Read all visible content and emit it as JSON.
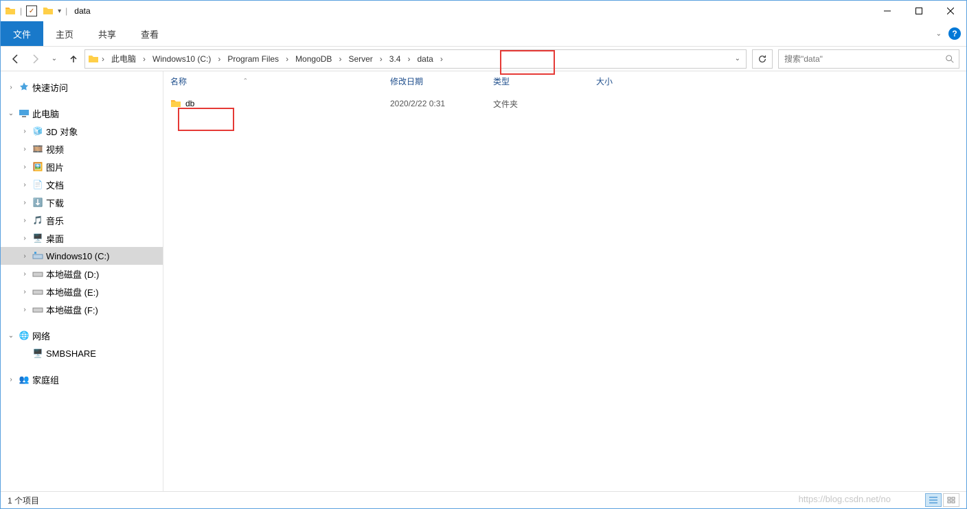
{
  "title": "data",
  "ribbon": {
    "file": "文件",
    "home": "主页",
    "share": "共享",
    "view": "查看"
  },
  "breadcrumb": [
    "此电脑",
    "Windows10 (C:)",
    "Program Files",
    "MongoDB",
    "Server",
    "3.4",
    "data"
  ],
  "search_placeholder": "搜索\"data\"",
  "columns": {
    "name": "名称",
    "date": "修改日期",
    "type": "类型",
    "size": "大小"
  },
  "rows": [
    {
      "name": "db",
      "date": "2020/2/22 0:31",
      "type": "文件夹",
      "size": ""
    }
  ],
  "tree": {
    "quick": "快速访问",
    "pc": "此电脑",
    "pc_children": [
      "3D 对象",
      "视频",
      "图片",
      "文档",
      "下载",
      "音乐",
      "桌面",
      "Windows10 (C:)",
      "本地磁盘 (D:)",
      "本地磁盘 (E:)",
      "本地磁盘 (F:)"
    ],
    "network": "网络",
    "network_children": [
      "SMBSHARE"
    ],
    "homegroup": "家庭组"
  },
  "status": "1 个项目",
  "watermark": "https://blog.csdn.net/no"
}
